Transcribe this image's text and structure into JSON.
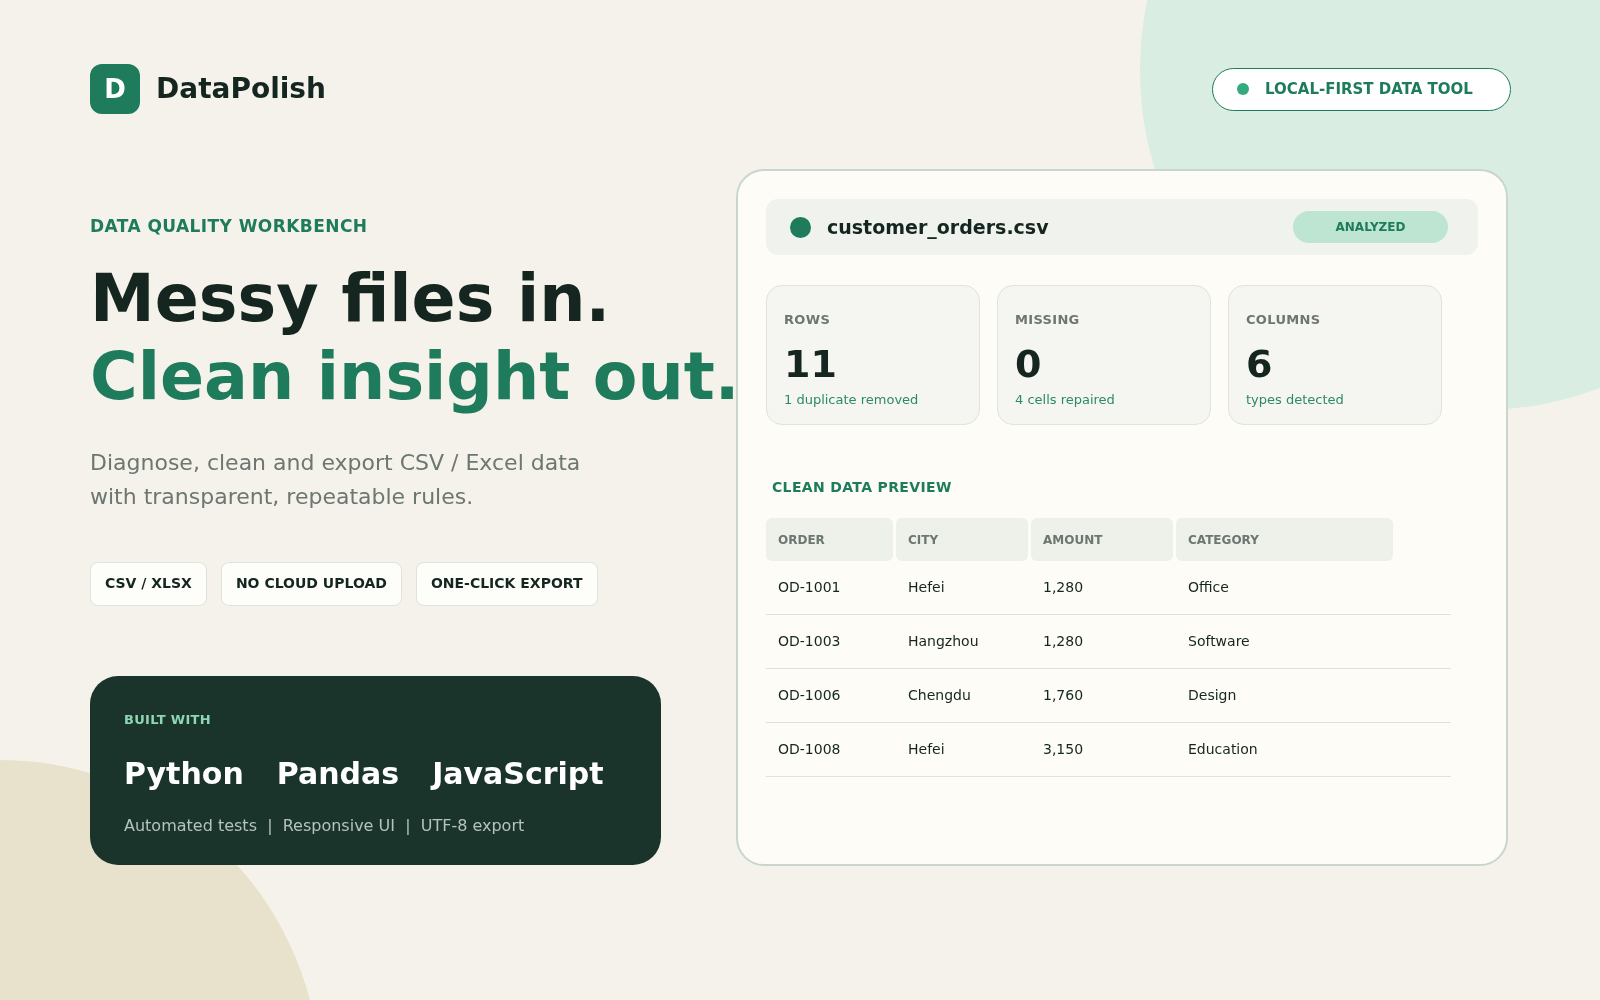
{
  "brand": {
    "logo_letter": "D",
    "name": "DataPolish"
  },
  "badge": {
    "label": "LOCAL-FIRST DATA TOOL"
  },
  "hero": {
    "eyebrow": "DATA QUALITY WORKBENCH",
    "headline": [
      "Messy files in.",
      "Clean insight out."
    ],
    "subtitle": "Diagnose, clean and export CSV / Excel data with transparent, repeatable rules.",
    "tags": [
      "CSV / XLSX",
      "NO CLOUD UPLOAD",
      "ONE-CLICK EXPORT"
    ]
  },
  "built_with": {
    "label": "BUILT WITH",
    "technologies": [
      "Python",
      "Pandas",
      "JavaScript"
    ],
    "features": "Automated tests  |  Responsive UI  |  UTF-8 export"
  },
  "file": {
    "name": "customer_orders.csv",
    "status": "ANALYZED"
  },
  "stats": [
    {
      "label": "ROWS",
      "value": "11",
      "note": "1 duplicate removed"
    },
    {
      "label": "MISSING",
      "value": "0",
      "note": "4 cells repaired"
    },
    {
      "label": "COLUMNS",
      "value": "6",
      "note": "types detected"
    }
  ],
  "preview": {
    "title": "CLEAN DATA PREVIEW",
    "columns": [
      "ORDER",
      "CITY",
      "AMOUNT",
      "CATEGORY"
    ],
    "rows": [
      [
        "OD-1001",
        "Hefei",
        "1,280",
        "Office"
      ],
      [
        "OD-1003",
        "Hangzhou",
        "1,280",
        "Software"
      ],
      [
        "OD-1006",
        "Chengdu",
        "1,760",
        "Design"
      ],
      [
        "OD-1008",
        "Hefei",
        "3,150",
        "Education"
      ]
    ]
  }
}
